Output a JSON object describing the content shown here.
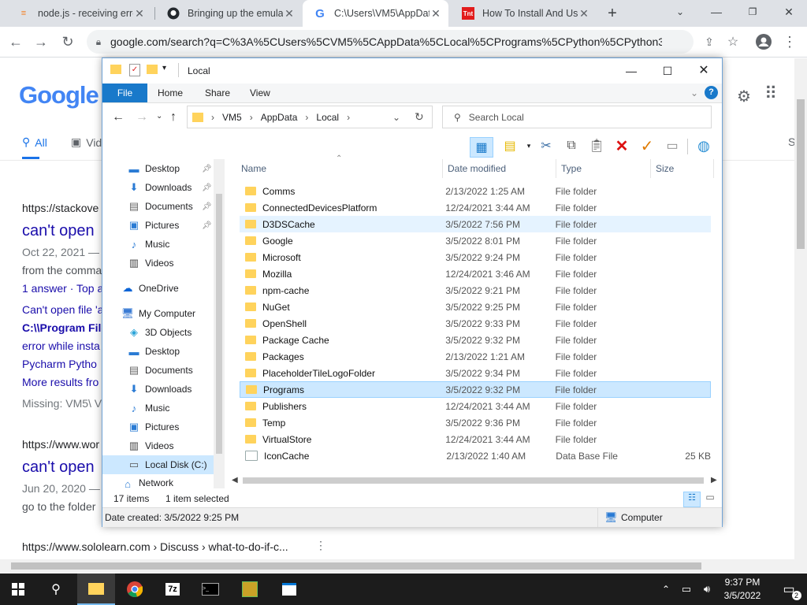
{
  "browser": {
    "tabs": [
      {
        "title": "node.js - receiving erro",
        "favicon": "stackoverflow-icon"
      },
      {
        "title": "Bringing up the emulat",
        "favicon": "github-icon"
      },
      {
        "title": "C:\\Users\\VM5\\AppData",
        "favicon": "google-icon"
      },
      {
        "title": "How To Install And Use",
        "favicon": "tnt-icon",
        "favicon_text": "Tnt"
      }
    ],
    "url": "google.com/search?q=C%3A%5CUsers%5CVM5%5CAppData%5CLocal%5CPrograms%5CPython%5CPython310%5Cp..."
  },
  "google": {
    "logo": "Google",
    "tabs": {
      "all": "All",
      "videos": "Vid",
      "settings_letter": "S"
    },
    "lines": [
      "https://stackove",
      "can't open",
      "Oct 22, 2021 —",
      "from the comma",
      "1 answer · Top a",
      "Can't open file 'a",
      "C:\\\\Program File",
      "error while insta",
      "Pycharm Pytho",
      "More results fro",
      "Missing: VM5\\ V",
      "https://www.wor",
      "can't open",
      "Jun 20, 2020 —",
      "go to the folder",
      "https://www.sololearn.com › Discuss › what-to-do-if-c..."
    ]
  },
  "explorer": {
    "title": "Local",
    "ribbon": {
      "file": "File",
      "home": "Home",
      "share": "Share",
      "view": "View"
    },
    "breadcrumb": [
      "VM5",
      "AppData",
      "Local"
    ],
    "search_placeholder": "Search Local",
    "nav": [
      {
        "label": "Desktop",
        "icon": "desktop-icon",
        "pinned": true
      },
      {
        "label": "Downloads",
        "icon": "downloads-icon",
        "pinned": true
      },
      {
        "label": "Documents",
        "icon": "documents-icon",
        "pinned": true
      },
      {
        "label": "Pictures",
        "icon": "pictures-icon",
        "pinned": true
      },
      {
        "label": "Music",
        "icon": "music-icon",
        "pinned": false
      },
      {
        "label": "Videos",
        "icon": "videos-icon",
        "pinned": false
      },
      {
        "label": "OneDrive",
        "icon": "onedrive-icon",
        "pinned": false
      },
      {
        "label": "My Computer",
        "icon": "computer-icon",
        "pinned": false
      },
      {
        "label": "3D Objects",
        "icon": "3d-objects-icon",
        "pinned": false
      },
      {
        "label": "Desktop",
        "icon": "desktop-icon",
        "pinned": false
      },
      {
        "label": "Documents",
        "icon": "documents-icon",
        "pinned": false
      },
      {
        "label": "Downloads",
        "icon": "downloads-icon",
        "pinned": false
      },
      {
        "label": "Music",
        "icon": "music-icon",
        "pinned": false
      },
      {
        "label": "Pictures",
        "icon": "pictures-icon",
        "pinned": false
      },
      {
        "label": "Videos",
        "icon": "videos-icon",
        "pinned": false
      },
      {
        "label": "Local Disk (C:)",
        "icon": "drive-icon",
        "pinned": false
      },
      {
        "label": "Network",
        "icon": "network-icon",
        "pinned": false
      }
    ],
    "columns": {
      "name": "Name",
      "date": "Date modified",
      "type": "Type",
      "size": "Size"
    },
    "files": [
      {
        "name": "Comms",
        "date": "2/13/2022 1:25 AM",
        "type": "File folder",
        "size": ""
      },
      {
        "name": "ConnectedDevicesPlatform",
        "date": "12/24/2021 3:44 AM",
        "type": "File folder",
        "size": ""
      },
      {
        "name": "D3DSCache",
        "date": "3/5/2022 7:56 PM",
        "type": "File folder",
        "size": "",
        "state": "hover"
      },
      {
        "name": "Google",
        "date": "3/5/2022 8:01 PM",
        "type": "File folder",
        "size": ""
      },
      {
        "name": "Microsoft",
        "date": "3/5/2022 9:24 PM",
        "type": "File folder",
        "size": ""
      },
      {
        "name": "Mozilla",
        "date": "12/24/2021 3:46 AM",
        "type": "File folder",
        "size": ""
      },
      {
        "name": "npm-cache",
        "date": "3/5/2022 9:21 PM",
        "type": "File folder",
        "size": ""
      },
      {
        "name": "NuGet",
        "date": "3/5/2022 9:25 PM",
        "type": "File folder",
        "size": ""
      },
      {
        "name": "OpenShell",
        "date": "3/5/2022 9:33 PM",
        "type": "File folder",
        "size": ""
      },
      {
        "name": "Package Cache",
        "date": "3/5/2022 9:32 PM",
        "type": "File folder",
        "size": ""
      },
      {
        "name": "Packages",
        "date": "2/13/2022 1:21 AM",
        "type": "File folder",
        "size": ""
      },
      {
        "name": "PlaceholderTileLogoFolder",
        "date": "3/5/2022 9:34 PM",
        "type": "File folder",
        "size": ""
      },
      {
        "name": "Programs",
        "date": "3/5/2022 9:32 PM",
        "type": "File folder",
        "size": "",
        "state": "selected"
      },
      {
        "name": "Publishers",
        "date": "12/24/2021 3:44 AM",
        "type": "File folder",
        "size": ""
      },
      {
        "name": "Temp",
        "date": "3/5/2022 9:36 PM",
        "type": "File folder",
        "size": ""
      },
      {
        "name": "VirtualStore",
        "date": "12/24/2021 3:44 AM",
        "type": "File folder",
        "size": ""
      },
      {
        "name": "IconCache",
        "date": "2/13/2022 1:40 AM",
        "type": "Data Base File",
        "size": "25 KB",
        "kind": "file"
      }
    ],
    "status": {
      "items": "17 items",
      "selected": "1 item selected"
    },
    "details": {
      "created": "Date created: 3/5/2022 9:25 PM",
      "location": "Computer"
    }
  },
  "taskbar": {
    "time": "9:37 PM",
    "date": "3/5/2022",
    "notifications": "2",
    "apps": [
      "file-explorer-icon",
      "chrome-icon",
      "7zip-icon",
      "terminal-icon",
      "app-icon",
      "store-icon"
    ]
  },
  "colors": {
    "accent": "#1979ca",
    "selection": "#cce8ff",
    "hover": "#e5f3ff",
    "folder": "#ffd35c",
    "link": "#1a0dab"
  }
}
